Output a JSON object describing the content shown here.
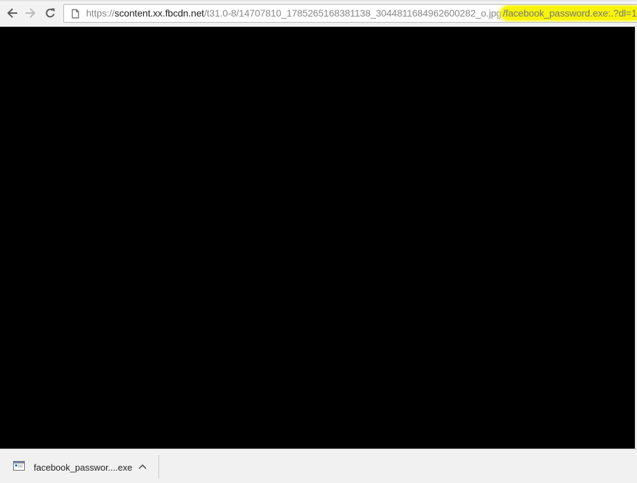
{
  "toolbar": {
    "back_icon": "arrow-left-icon",
    "forward_icon": "arrow-right-icon",
    "reload_icon": "reload-icon",
    "page_icon": "page-icon"
  },
  "omnibox": {
    "url_scheme": "https://",
    "url_host": "scontent.xx.fbcdn.net",
    "url_path": "/t31.0-8/14707810_1785265168381138_3044811684962600282_o.jpg",
    "url_highlighted": "/facebook_password.exe:.?dl=1",
    "highlight_color": "#f7f40a"
  },
  "content": {
    "background": "#000000"
  },
  "download_shelf": {
    "item": {
      "file_name": "facebook_passwor....exe",
      "icon": "exe-file-icon",
      "menu_icon": "chevron-up-icon"
    }
  }
}
